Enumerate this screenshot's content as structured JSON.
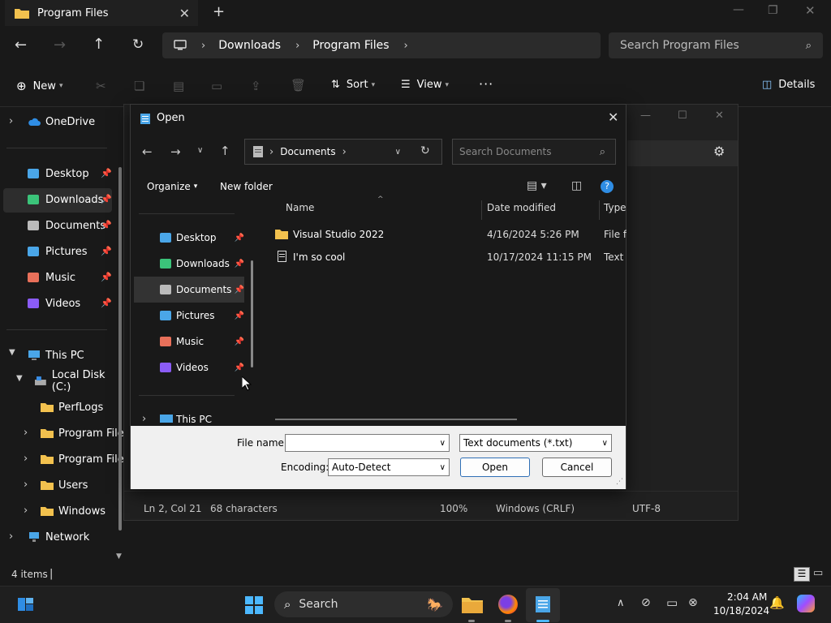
{
  "explorer": {
    "tab_title": "Program Files",
    "breadcrumb": [
      "Downloads",
      "Program Files"
    ],
    "search_placeholder": "Search Program Files",
    "toolbar": {
      "new": "New",
      "sort": "Sort",
      "view": "View",
      "details": "Details"
    },
    "sidebar": {
      "onedrive": "OneDrive",
      "pinned": [
        {
          "label": "Desktop",
          "icon": "desktop-icon"
        },
        {
          "label": "Downloads",
          "icon": "downloads-icon"
        },
        {
          "label": "Documents",
          "icon": "documents-icon"
        },
        {
          "label": "Pictures",
          "icon": "pictures-icon"
        },
        {
          "label": "Music",
          "icon": "music-icon"
        },
        {
          "label": "Videos",
          "icon": "videos-icon"
        }
      ],
      "this_pc": "This PC",
      "local_disk": "Local Disk (C:)",
      "folders": [
        "PerfLogs",
        "Program File",
        "Program File",
        "Users",
        "Windows"
      ],
      "network": "Network"
    },
    "status": "4 items"
  },
  "notepad": {
    "status": {
      "position": "Ln 2, Col 21",
      "chars": "68 characters",
      "zoom": "100%",
      "line_ending": "Windows (CRLF)",
      "encoding": "UTF-8"
    }
  },
  "dialog": {
    "title": "Open",
    "address": "Documents",
    "search_placeholder": "Search Documents",
    "organize": "Organize",
    "new_folder": "New folder",
    "nav": [
      "Desktop",
      "Downloads",
      "Documents",
      "Pictures",
      "Music",
      "Videos"
    ],
    "this_pc": "This PC",
    "columns": {
      "name": "Name",
      "date": "Date modified",
      "type": "Type"
    },
    "files": [
      {
        "name": "Visual Studio 2022",
        "date": "4/16/2024 5:26 PM",
        "type": "File fo",
        "icon": "folder-icon"
      },
      {
        "name": "I'm so cool",
        "date": "10/17/2024 11:15 PM",
        "type": "Text D",
        "icon": "text-file-icon"
      }
    ],
    "file_name_label": "File name:",
    "file_name_value": "",
    "file_type": "Text documents (*.txt)",
    "encoding_label": "Encoding:",
    "encoding_value": "Auto-Detect",
    "open_button": "Open",
    "cancel_button": "Cancel"
  },
  "taskbar": {
    "search": "Search",
    "time": "2:04 AM",
    "date": "10/18/2024"
  }
}
